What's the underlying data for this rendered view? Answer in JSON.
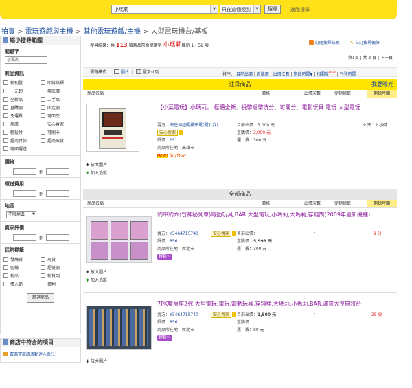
{
  "search": {
    "value": "小瑪莉",
    "category": "只在這個類別",
    "button": "搜尋",
    "advanced": "進階搜尋"
  },
  "breadcrumb": {
    "items": [
      "拍賣",
      "電玩遊戲與主機",
      "其他電玩遊戲/主機",
      "大型電玩機台/基板"
    ],
    "sep": " > "
  },
  "sidebar": {
    "title": "縮小搜尋範圍",
    "keyword_label": "關鍵字",
    "keyword_value": "小瑪莉",
    "info_label": "商品資訊",
    "info_options": [
      "新刊登",
      "即將結標",
      "一元起",
      "無底價",
      "全新品",
      "二手品",
      "直購價",
      "固定價",
      "免運費",
      "可面交",
      "商店",
      "安心賣家",
      "輕鬆付",
      "可刷卡",
      "超商付款",
      "超商取貨",
      "跨國運送"
    ],
    "price_label": "價格",
    "shipping_label": "運送費用",
    "to": "到",
    "region_label": "地區",
    "region_value": "不限地區",
    "rating_label": "賣家評價",
    "promo_label": "促銷標籤",
    "promo_options": [
      "發燒貨",
      "現貨",
      "促銷",
      "超低價",
      "新品",
      "新貨到",
      "情人節",
      "禮物"
    ],
    "filter_button": "篩選商品",
    "store_title": "商店中符合的項目",
    "store_item": "富源寶藏店活動達人會(1)"
  },
  "results": {
    "summary_pre": "搜尋結果：共",
    "count": "113",
    "summary_mid": "項商品符合關鍵字",
    "keyword": "小瑪莉",
    "summary_post": "顯示 1 - 51 項",
    "subscribe": "訂閱搜尋結果",
    "save": "自訂搜尋偏好",
    "paging": "第1頁 | 共 3 頁 | 下一頁"
  },
  "toolbar": {
    "view_label": "瀏覽模式：",
    "view_grid": "圖片",
    "view_list": "圖文並列",
    "sort_label": "排序：",
    "sort_items": [
      "目前出價",
      "直購價",
      "出價次數",
      "剩餘時間",
      "相關度",
      "刊登時間"
    ],
    "new_tag": "NEW"
  },
  "featured": {
    "title": "注目商品",
    "buy_link": "我要曝光",
    "cols": {
      "name": "商品名稱",
      "price": "價格",
      "bids": "出價次數",
      "promo": "促銷標籤",
      "time": "剩餘時間"
    },
    "item": {
      "title": "【小菜電玩】小瑪莉。 框體全新、投幣退幣洗分、可開分、電動玩具 電玩 大型電玩",
      "seller_label": "賣方：",
      "seller": "海任何經開排來電(關於我)",
      "safe": "安心賣家",
      "rating_label": "評價：",
      "rating": "151",
      "loc_label": "商品所在地：",
      "loc": "高雄市",
      "new_tag": "NEW!",
      "buynow": "BuyNow",
      "cur_label": "目前出價：",
      "cur": "3,000 元",
      "buy_label": "直購價：",
      "buy": "3,000 元",
      "ship_label": "運　費：",
      "ship": "300 元",
      "bids": "-",
      "time": "9 天 12 小時",
      "enlarge": "放大圖片",
      "track": "加入追蹤"
    }
  },
  "all": {
    "title": "全部商品",
    "cols": {
      "name": "商品名稱",
      "price": "價格",
      "bids": "出價次數",
      "promo": "促銷標籤",
      "time": "剩餘時間"
    },
    "items": [
      {
        "title": "豹中豹六代(神秘列車)電動玩具,BAR,大型電玩,小瑪莉,大瑪莉,存錢筒(2009年最新機種)",
        "seller_label": "賣方：",
        "seller": "Y3464715740",
        "safe": "安心賣家",
        "rating_label": "評價：",
        "rating": "856",
        "loc_label": "商品所在地：",
        "loc": "新北市",
        "badge": "輕鬆付",
        "cur_label": "目前出價：",
        "cur": "",
        "buy_label": "直購價：",
        "buy": "5,999 元",
        "ship_label": "運　費：",
        "ship": "300 元",
        "bids": "-",
        "time": "9 分",
        "enlarge": "放大圖片",
        "track": "加入追蹤"
      },
      {
        "title": "7PK雙魚座2代,大型電玩,電玩,電動玩具,存錢桶,大瑪莉,小瑪莉,BAR,滿貫大亨麻將台",
        "seller_label": "賣方：",
        "seller": "Y3464715740",
        "safe": "安心賣家",
        "rating_label": "評價：",
        "rating": "856",
        "loc_label": "商品所在地：",
        "loc": "新北市",
        "badge": "輕鬆付",
        "cur_label": "目前出價：",
        "cur": "1,500 元",
        "buy_label": "直購價：",
        "buy": "",
        "ship_label": "運　費：",
        "ship": "80 元",
        "bids": "-",
        "time": "25 分",
        "enlarge": "放大圖片",
        "track": "加入追蹤"
      }
    ]
  },
  "colors": {
    "yellow": "#ffe11a",
    "link": "#1a4c9c",
    "red": "#e02020",
    "title": "#8a1a9a"
  }
}
